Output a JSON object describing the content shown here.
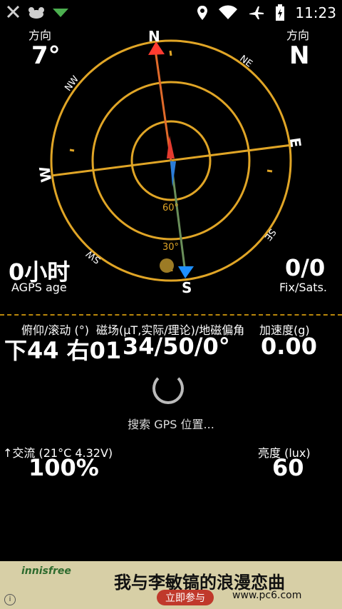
{
  "status_bar": {
    "time": "11:23",
    "left_icons": [
      "no-signal-icon",
      "cat-icon",
      "download-icon"
    ],
    "right_icons": [
      "location-icon",
      "wifi-icon",
      "airplane-icon",
      "battery-charging-icon"
    ]
  },
  "compass": {
    "heading_left_label": "方向",
    "heading_left_value": "7°",
    "heading_right_label": "方向",
    "heading_right_value": "N",
    "cardinals": {
      "N": "N",
      "NE": "NE",
      "E": "E",
      "SE": "SE",
      "S": "S",
      "SW": "SW",
      "W": "W",
      "NW": "NW"
    },
    "ring_labels": {
      "sixty": "60°",
      "thirty": "30°"
    },
    "agps_value": "0小时",
    "agps_label": "AGPS age",
    "fix_value": "0/0",
    "fix_label": "Fix/Sats."
  },
  "sensors": {
    "tilt_label": "俯仰/滚动 (°)",
    "mag_label": "磁场(μT,实际/理论)/地磁偏角",
    "accel_label": "加速度(g)",
    "tilt_value": "下44 右01",
    "mag_value": "34/50/0°",
    "accel_value": "0.00"
  },
  "gps": {
    "searching_text": "搜索 GPS 位置..."
  },
  "battery": {
    "label": "↑交流 (21°C 4.32V)",
    "value": "100%"
  },
  "light": {
    "label": "亮度 (lux)",
    "value": "60"
  },
  "ad": {
    "brand": "innisfree",
    "headline": "我与李敏镐的浪漫恋曲",
    "button": "立即参与",
    "watermark": "www.pc6.com",
    "info": "i"
  },
  "colors": {
    "ring": "#e0a526",
    "north": "#ff3b30",
    "south": "#1e90ff",
    "needle_top": "#e06a2a",
    "needle_bottom": "#6a8f5a"
  }
}
